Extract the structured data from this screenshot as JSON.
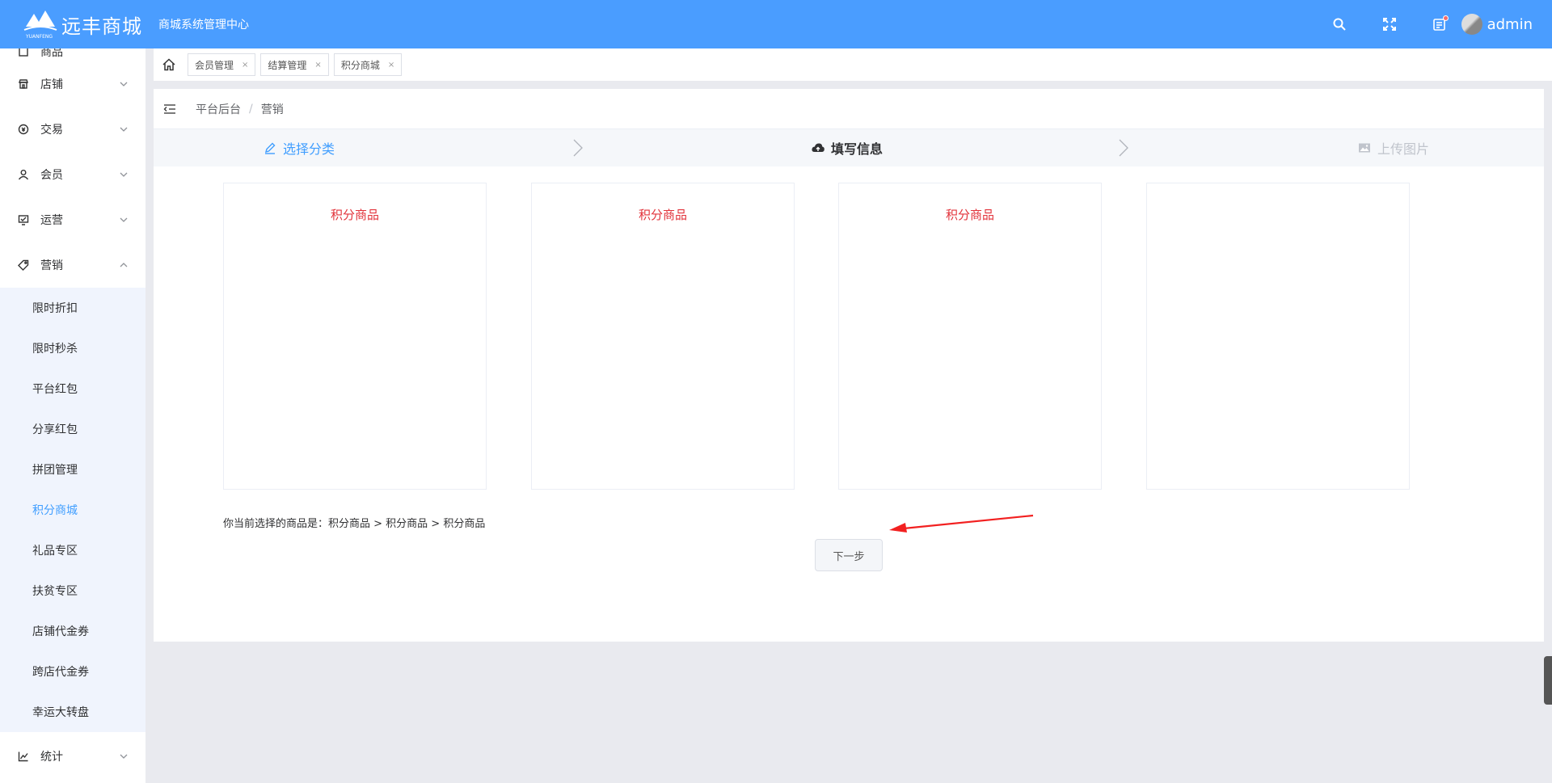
{
  "header": {
    "logo_text": "远丰商城",
    "logo_sub": "YUANFENG",
    "subtitle": "商城系统管理中心",
    "username": "admin",
    "icons": [
      "search-icon",
      "fullscreen-icon",
      "message-icon"
    ]
  },
  "sidebar": {
    "partial_item": "商品",
    "items": [
      {
        "label": "店铺",
        "icon": "shop-icon"
      },
      {
        "label": "交易",
        "icon": "trade-icon"
      },
      {
        "label": "会员",
        "icon": "user-icon"
      },
      {
        "label": "运营",
        "icon": "operation-icon"
      },
      {
        "label": "营销",
        "icon": "tag-icon",
        "expanded": true
      }
    ],
    "submenu": [
      "限时折扣",
      "限时秒杀",
      "平台红包",
      "分享红包",
      "拼团管理",
      "积分商城",
      "礼品专区",
      "扶贫专区",
      "店铺代金券",
      "跨店代金券",
      "幸运大转盘"
    ],
    "active_sub": "积分商城",
    "bottom_item": {
      "label": "统计",
      "icon": "chart-icon"
    }
  },
  "tabs": [
    {
      "label": "会员管理"
    },
    {
      "label": "结算管理"
    },
    {
      "label": "积分商城"
    }
  ],
  "breadcrumb": [
    "平台后台",
    "营销"
  ],
  "steps": [
    {
      "label": "选择分类",
      "state": "active"
    },
    {
      "label": "填写信息",
      "state": "current"
    },
    {
      "label": "上传图片",
      "state": "disabled"
    }
  ],
  "categories": [
    {
      "label": "积分商品"
    },
    {
      "label": "积分商品"
    },
    {
      "label": "积分商品"
    },
    {
      "label": ""
    }
  ],
  "selection_text": "你当前选择的商品是：积分商品 > 积分商品 > 积分商品",
  "next_button": "下一步",
  "colors": {
    "header": "#4a9dff",
    "accent": "#409eff",
    "category_text": "#e2333b",
    "annotation_arrow": "#f22020"
  }
}
